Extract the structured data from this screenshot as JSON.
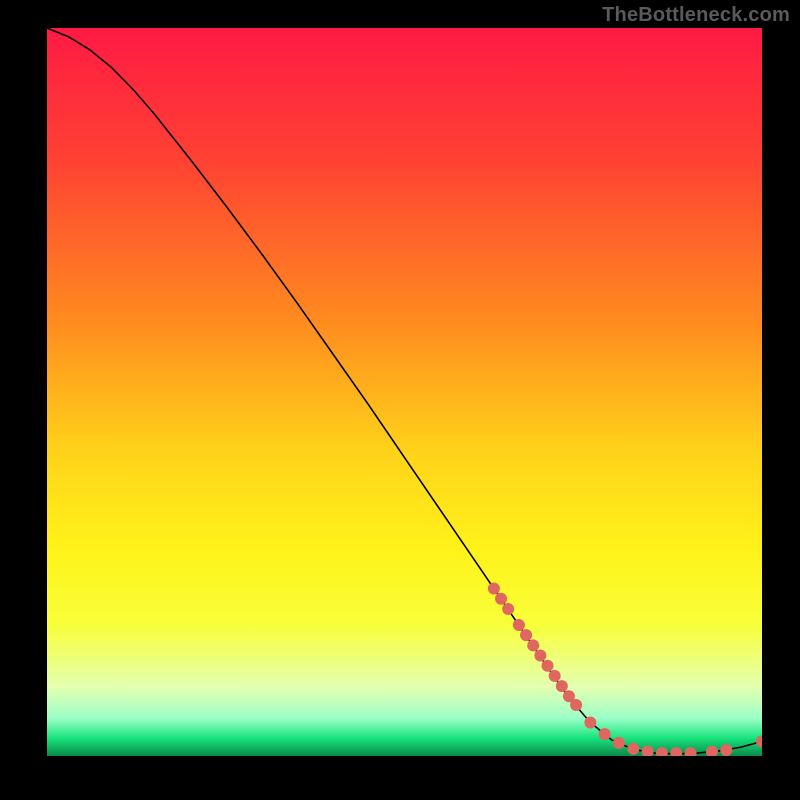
{
  "watermark": "TheBottleneck.com",
  "chart_data": {
    "type": "line",
    "title": "",
    "xlabel": "",
    "ylabel": "",
    "xlim": [
      0,
      100
    ],
    "ylim": [
      0,
      100
    ],
    "background_gradient": {
      "stops": [
        {
          "offset": 0.0,
          "color": "#ff1a44"
        },
        {
          "offset": 0.18,
          "color": "#ff4133"
        },
        {
          "offset": 0.4,
          "color": "#ff8a1f"
        },
        {
          "offset": 0.58,
          "color": "#ffd21a"
        },
        {
          "offset": 0.72,
          "color": "#fff31a"
        },
        {
          "offset": 0.82,
          "color": "#f8ff3a"
        },
        {
          "offset": 0.905,
          "color": "#e4ffb0"
        },
        {
          "offset": 0.948,
          "color": "#9cffc8"
        },
        {
          "offset": 0.975,
          "color": "#18e57e"
        },
        {
          "offset": 1.0,
          "color": "#0a8a48"
        }
      ]
    },
    "series": [
      {
        "name": "curve",
        "type": "line",
        "color": "#000000",
        "width": 1.6,
        "x": [
          0,
          3,
          6,
          9,
          12,
          15,
          20,
          25,
          30,
          35,
          40,
          45,
          50,
          55,
          60,
          65,
          70,
          73,
          76,
          79,
          82,
          85,
          88,
          91,
          94,
          97,
          100
        ],
        "y": [
          100,
          98.8,
          97.0,
          94.6,
          91.6,
          88.2,
          82.0,
          75.6,
          69.0,
          62.2,
          55.2,
          48.2,
          41.0,
          33.8,
          26.6,
          19.4,
          12.2,
          8.0,
          4.6,
          2.2,
          0.9,
          0.4,
          0.3,
          0.4,
          0.7,
          1.2,
          2.0
        ]
      },
      {
        "name": "markers",
        "type": "scatter",
        "color": "#e06660",
        "radius": 6.0,
        "x": [
          62.5,
          63.5,
          64.5,
          66.0,
          67.0,
          68.0,
          69.0,
          70.0,
          71.0,
          72.0,
          73.0,
          74.0,
          76.0,
          78.0,
          80.0,
          82.0,
          84.0,
          86.0,
          88.0,
          90.0,
          93.0,
          95.0,
          100.0
        ],
        "y": [
          23.0,
          21.6,
          20.2,
          18.0,
          16.6,
          15.2,
          13.8,
          12.4,
          11.0,
          9.6,
          8.2,
          7.0,
          4.6,
          3.0,
          1.8,
          1.0,
          0.6,
          0.4,
          0.4,
          0.4,
          0.6,
          0.8,
          2.0
        ]
      }
    ]
  }
}
